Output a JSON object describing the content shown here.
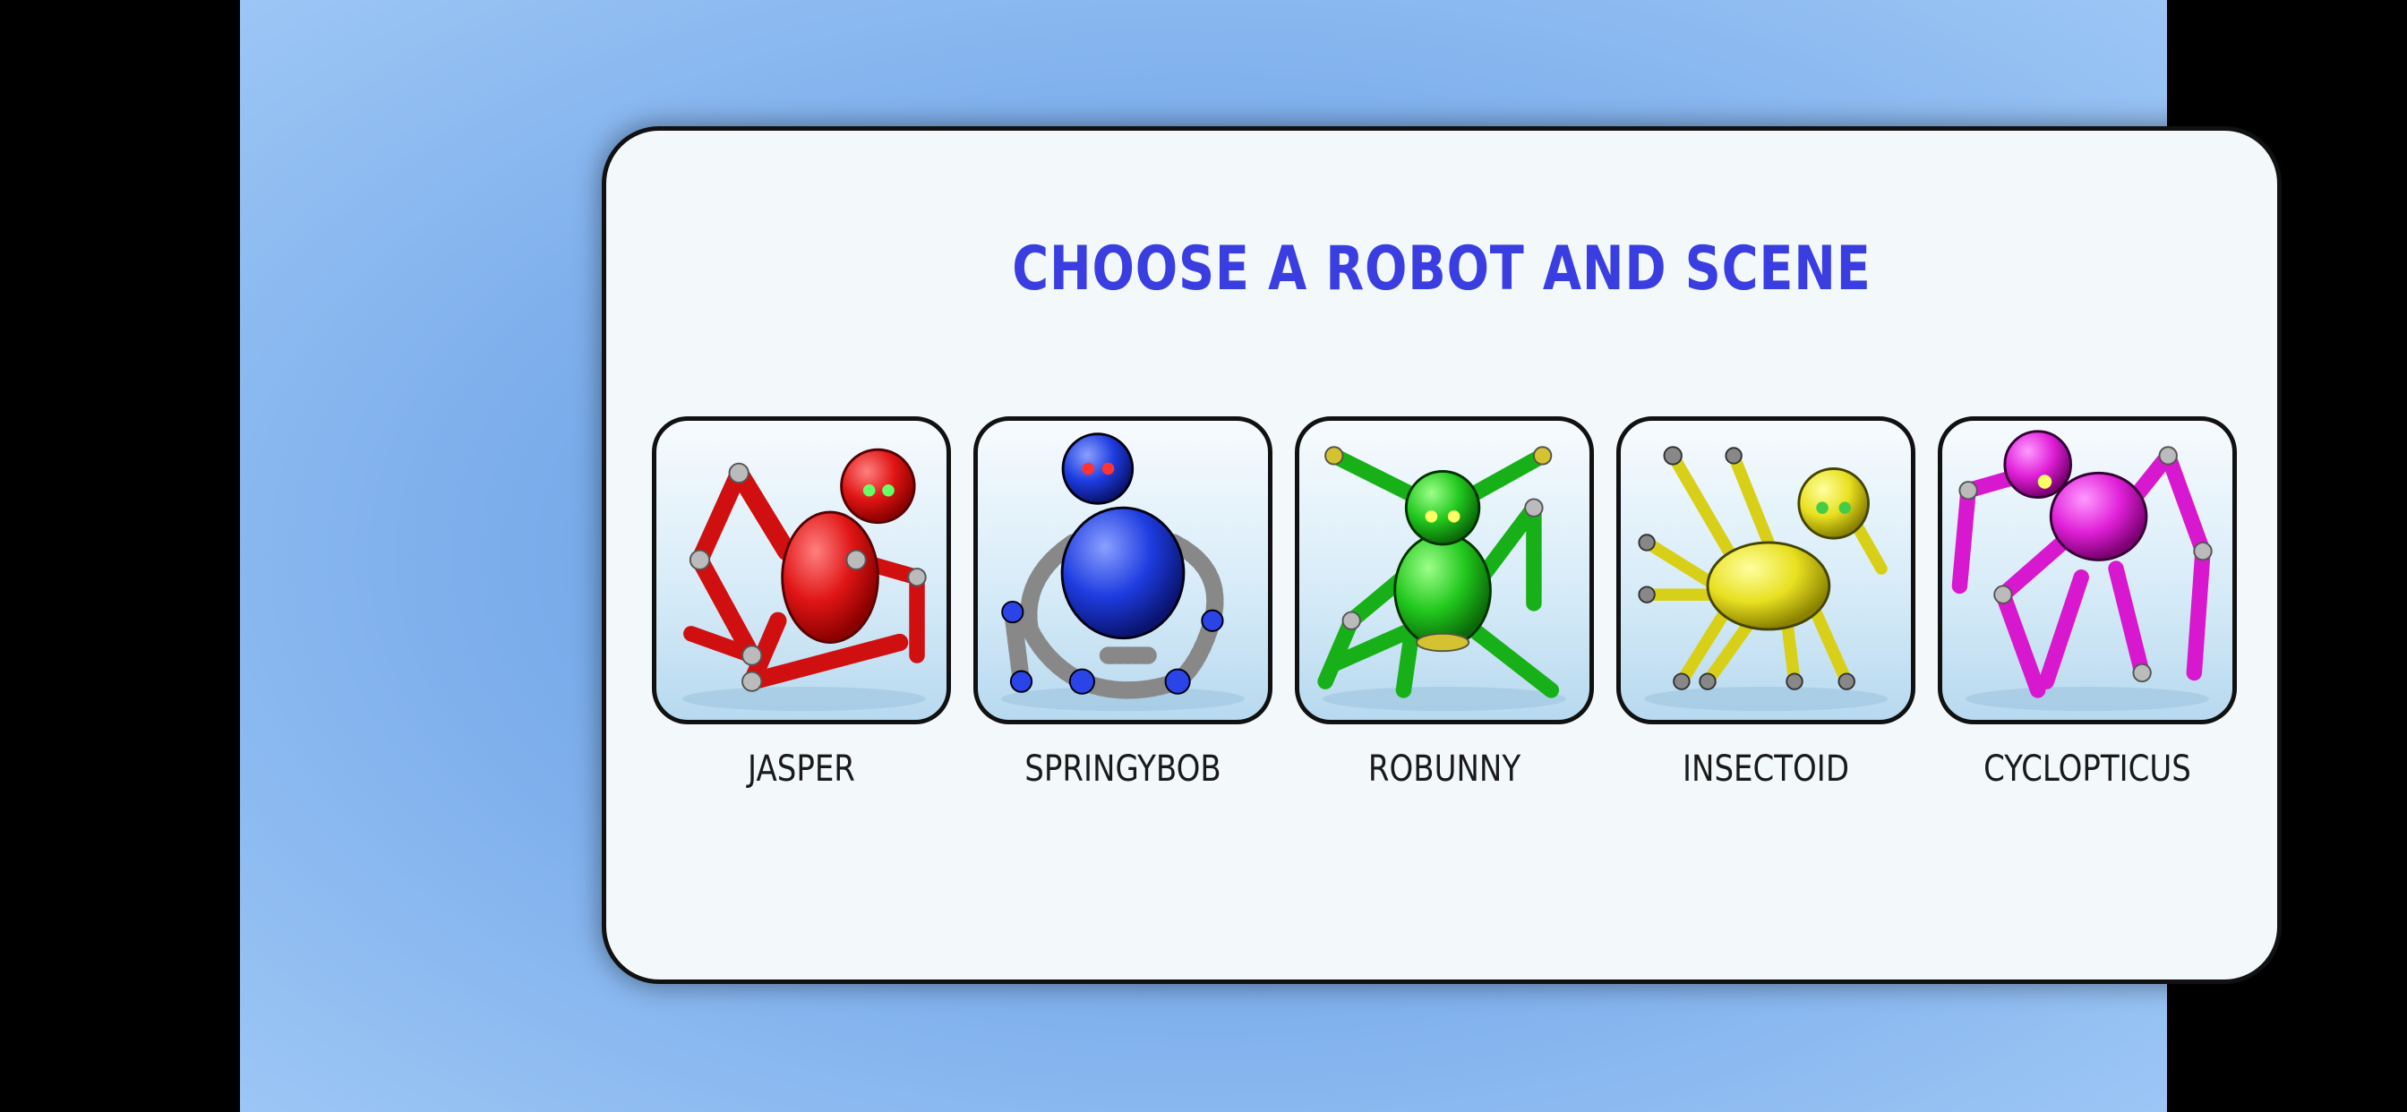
{
  "screen": {
    "title": "CHOOSE A ROBOT AND SCENE"
  },
  "robots": [
    {
      "name": "JASPER",
      "icon": "red-robot-icon",
      "color": "#e01515"
    },
    {
      "name": "SPRINGYBOB",
      "icon": "blue-robot-icon",
      "color": "#1e3ce0"
    },
    {
      "name": "ROBUNNY",
      "icon": "green-robot-icon",
      "color": "#22c81e"
    },
    {
      "name": "INSECTOID",
      "icon": "yellow-robot-icon",
      "color": "#e8e020"
    },
    {
      "name": "CYCLOPTICUS",
      "icon": "magenta-robot-icon",
      "color": "#e020d8"
    }
  ],
  "colors": {
    "title": "#3a3ee0",
    "panel": "#f3f8fb",
    "background": "#78aaea"
  }
}
